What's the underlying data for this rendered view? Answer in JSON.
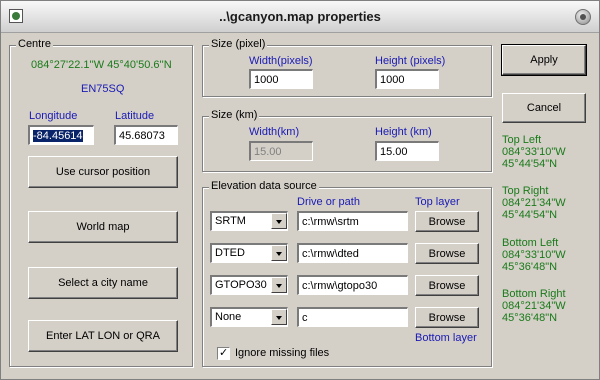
{
  "window": {
    "title": "..\\gcanyon.map properties"
  },
  "centre": {
    "label": "Centre",
    "coords": "084°27'22.1''W 45°40'50.6''N",
    "locator": "EN75SQ",
    "longitude_label": "Longitude",
    "latitude_label": "Latitude",
    "longitude_value": "-84.45614",
    "latitude_value": "45.68073",
    "buttons": {
      "cursor": "Use cursor position",
      "world": "World map",
      "city": "Select a city name",
      "latlon": "Enter LAT LON or QRA"
    }
  },
  "size_pixel": {
    "label": "Size (pixel)",
    "width_label": "Width(pixels)",
    "height_label": "Height (pixels)",
    "width_value": "1000",
    "height_value": "1000"
  },
  "size_km": {
    "label": "Size (km)",
    "width_label": "Width(km)",
    "height_label": "Height (km)",
    "width_value": "15.00",
    "height_value": "15.00"
  },
  "elevation": {
    "label": "Elevation data source",
    "col_path": "Drive or path",
    "top_layer": "Top layer",
    "bottom_layer": "Bottom layer",
    "rows": [
      {
        "type": "SRTM",
        "path": "c:\\rmw\\srtm",
        "browse": "Browse"
      },
      {
        "type": "DTED",
        "path": "c:\\rmw\\dted",
        "browse": "Browse"
      },
      {
        "type": "GTOPO30",
        "path": "c:\\rmw\\gtopo30",
        "browse": "Browse"
      },
      {
        "type": "None",
        "path": "c",
        "browse": "Browse"
      }
    ],
    "ignore_missing": "Ignore missing files",
    "ignore_missing_checked": true
  },
  "actions": {
    "apply": "Apply",
    "cancel": "Cancel"
  },
  "corners": {
    "top_left": {
      "label": "Top Left",
      "lon": "084°33'10\"W",
      "lat": "45°44'54\"N"
    },
    "top_right": {
      "label": "Top Right",
      "lon": "084°21'34\"W",
      "lat": "45°44'54\"N"
    },
    "bottom_left": {
      "label": "Bottom Left",
      "lon": "084°33'10\"W",
      "lat": "45°36'48\"N"
    },
    "bottom_right": {
      "label": "Bottom Right",
      "lon": "084°21'34\"W",
      "lat": "45°36'48\"N"
    }
  }
}
